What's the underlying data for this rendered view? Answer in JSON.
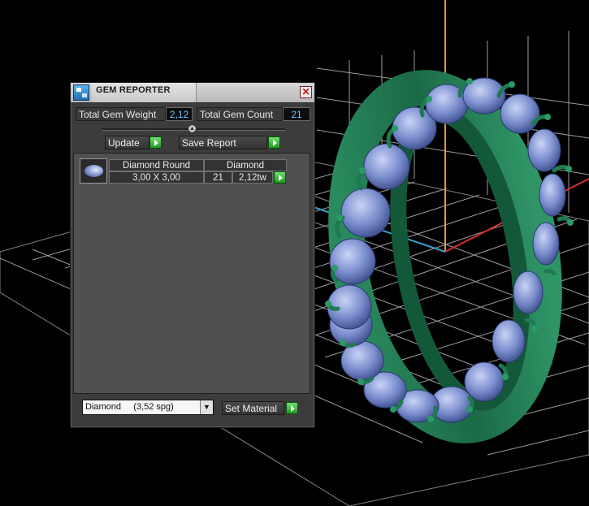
{
  "window": {
    "title": "GEM REPORTER",
    "close_label": "✕"
  },
  "summary": {
    "total_weight_label": "Total Gem Weight",
    "total_weight_value": "2,12",
    "total_count_label": "Total Gem Count",
    "total_count_value": "21"
  },
  "actions": {
    "update_label": "Update",
    "save_report_label": "Save Report"
  },
  "gems": [
    {
      "thumbnail": "round-gem-icon",
      "shape": "Diamond Round",
      "material": "Diamond",
      "size": "3,00 X 3,00",
      "count": "21",
      "weight": "2,12tw"
    }
  ],
  "footer": {
    "material_select": "Diamond     (3,52 spg)",
    "set_material_label": "Set Material"
  },
  "colors": {
    "accent_value": "#65c6ff",
    "play_green": "#2fb82f",
    "gem_blue": "#7c8fcf",
    "prong_green": "#1f7a52"
  }
}
